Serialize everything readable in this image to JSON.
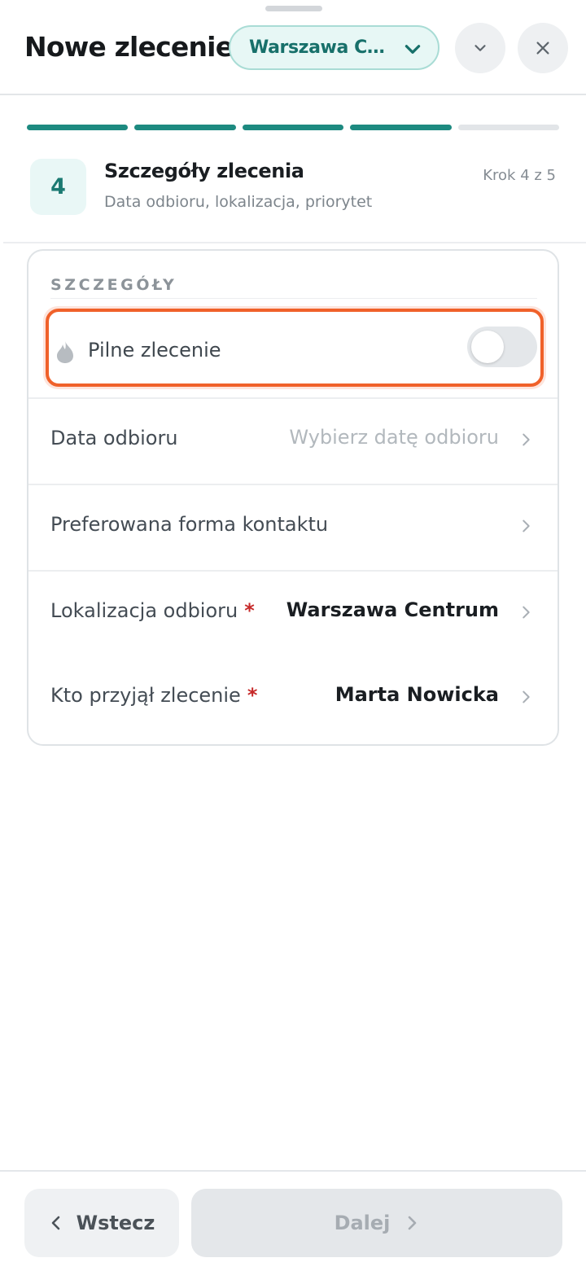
{
  "header": {
    "title": "Nowe zlecenie",
    "location_pill": "Warszawa Centrum",
    "collapse_icon": "chevron-down-icon",
    "close_icon": "close-icon"
  },
  "progress": {
    "total_steps": 5,
    "completed_steps": 4
  },
  "step": {
    "number": "4",
    "title": "Szczegóły zlecenia",
    "subtitle": "Data odbioru, lokalizacja, priorytet",
    "counter": "Krok 4 z 5"
  },
  "details": {
    "section_label": "SZCZEGÓŁY",
    "urgent": {
      "label": "Pilne zlecenie",
      "icon": "flame-icon",
      "enabled": false
    },
    "rows": [
      {
        "label": "Data odbioru",
        "value": "Wybierz datę odbioru",
        "required": false,
        "placeholder": true
      },
      {
        "label": "Preferowana forma kontaktu",
        "value": "",
        "required": false,
        "placeholder": false
      },
      {
        "label": "Lokalizacja odbioru",
        "value": "Warszawa Centrum",
        "required": true,
        "placeholder": false
      },
      {
        "label": "Kto przyjął zlecenie",
        "value": "Marta Nowicka",
        "required": true,
        "placeholder": false
      }
    ],
    "required_marker": "*"
  },
  "footer": {
    "back_label": "Wstecz",
    "next_label": "Dalej"
  },
  "colors": {
    "accent": "#1d8a80",
    "highlight": "#f0612a",
    "required": "#c62828"
  }
}
